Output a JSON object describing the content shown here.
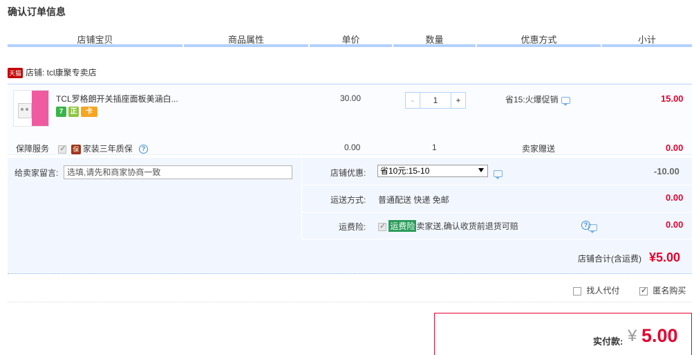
{
  "page": {
    "title": "确认订单信息"
  },
  "table_headers": [
    "店铺宝贝",
    "商品属性",
    "单价",
    "数量",
    "优惠方式",
    "小计"
  ],
  "shop": {
    "badge": "天猫",
    "label": "店铺: tcl康聚专卖店"
  },
  "item": {
    "title": "TCL罗格朗开关插座面板美涵白...",
    "service_icons": [
      {
        "name": "seven-day-return-icon",
        "text": "7",
        "color": "#3bb44a"
      },
      {
        "name": "quality-guarantee-icon",
        "text": "正",
        "color": "#8cc63f"
      },
      {
        "name": "credit-card-icon",
        "text": "卡",
        "color": "#f6a623"
      }
    ],
    "unit_price": "30.00",
    "quantity": "1",
    "minus": "-",
    "plus": "+",
    "promotion": "省15:火爆促销",
    "subtotal": "15.00"
  },
  "guarantee": {
    "label": "保障服务",
    "bao": "保",
    "service": "家装三年质保",
    "help": "?",
    "price": "0.00",
    "quantity": "1",
    "method": "卖家赠送",
    "subtotal": "0.00"
  },
  "message": {
    "label": "给卖家留言:",
    "placeholder": "选填,请先和商家协商一致"
  },
  "shop_discount": {
    "label": "店铺优惠:",
    "selected": "省10元:15-10",
    "amount": "-10.00"
  },
  "shipping": {
    "label": "运送方式:",
    "value": "普通配送 快递 免邮",
    "amount": "0.00"
  },
  "freight_insurance": {
    "label": "运费险:",
    "tag": "运费险",
    "desc": "卖家送,确认收货前退货可赔",
    "help": "?",
    "amount": "0.00"
  },
  "shop_total": {
    "label": "店铺合计(含运费)",
    "value": "¥5.00"
  },
  "options": {
    "proxy_pay": "找人代付",
    "anonymous": "匿名购买"
  },
  "payment": {
    "label": "实付款:",
    "yen": "¥",
    "value": "5.00"
  }
}
